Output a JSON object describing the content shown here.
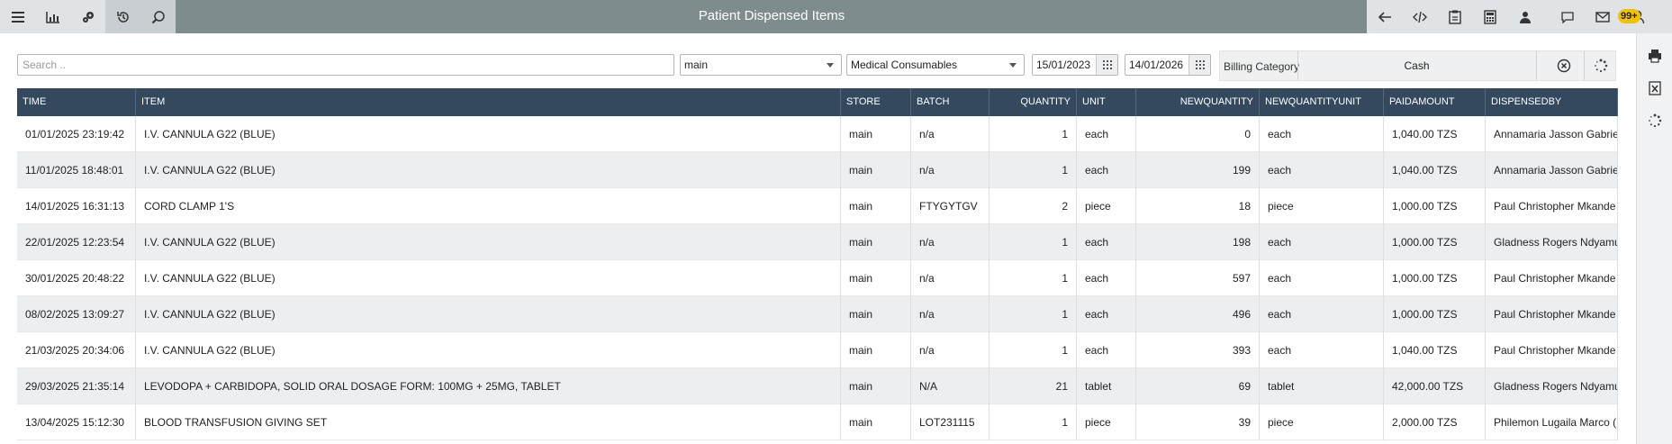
{
  "title": "Patient Dispensed Items",
  "badge": "99+",
  "search": {
    "placeholder": "Search .."
  },
  "filters": {
    "store": "main",
    "category": "Medical Consumables",
    "from_date": "15/01/2023",
    "to_date": "14/01/2026",
    "billing_label": "Billing Category",
    "billing_value": "Cash"
  },
  "icons": {
    "left": [
      "menu-icon",
      "bar-chart-icon",
      "settings-gears-icon",
      "history-icon",
      "search-icon"
    ],
    "right": [
      "back-arrow-icon",
      "code-icon",
      "clipboard-icon",
      "calculator-icon",
      "user-card-icon",
      "chat-icon",
      "mail-icon",
      "user-icon"
    ],
    "side": [
      "print-icon",
      "excel-icon",
      "refresh-spinner-icon"
    ]
  },
  "table": {
    "headers": [
      "TIME",
      "ITEM",
      "STORE",
      "BATCH",
      "QUANTITY",
      "UNIT",
      "NEWQUANTITY",
      "NEWQUANTITYUNIT",
      "PAIDAMOUNT",
      "DISPENSEDBY"
    ],
    "rows": [
      [
        "01/01/2025 23:19:42",
        "I.V. CANNULA G22 (BLUE)",
        "main",
        "n/a",
        "1",
        "each",
        "0",
        "each",
        "1,040.00 TZS",
        "Annamaria Jasson Gabriel ("
      ],
      [
        "11/01/2025 18:48:01",
        "I.V. CANNULA G22 (BLUE)",
        "main",
        "n/a",
        "1",
        "each",
        "199",
        "each",
        "1,040.00 TZS",
        "Annamaria Jasson Gabriel ("
      ],
      [
        "14/01/2025 16:31:13",
        "CORD CLAMP 1'S",
        "main",
        "FTYGYTGV",
        "2",
        "piece",
        "18",
        "piece",
        "1,000.00 TZS",
        "Paul Christopher Mkande (M"
      ],
      [
        "22/01/2025 12:23:54",
        "I.V. CANNULA G22 (BLUE)",
        "main",
        "n/a",
        "1",
        "each",
        "198",
        "each",
        "1,000.00 TZS",
        "Gladness Rogers Ndyamuka"
      ],
      [
        "30/01/2025 20:48:22",
        "I.V. CANNULA G22 (BLUE)",
        "main",
        "n/a",
        "1",
        "each",
        "597",
        "each",
        "1,000.00 TZS",
        "Paul Christopher Mkande (M"
      ],
      [
        "08/02/2025 13:09:27",
        "I.V. CANNULA G22 (BLUE)",
        "main",
        "n/a",
        "1",
        "each",
        "496",
        "each",
        "1,000.00 TZS",
        "Paul Christopher Mkande (M"
      ],
      [
        "21/03/2025 20:34:06",
        "I.V. CANNULA G22 (BLUE)",
        "main",
        "n/a",
        "1",
        "each",
        "393",
        "each",
        "1,040.00 TZS",
        "Paul Christopher Mkande (M"
      ],
      [
        "29/03/2025 21:35:14",
        "LEVODOPA + CARBIDOPA, SOLID ORAL DOSAGE FORM: 100MG + 25MG, TABLET",
        "main",
        "N/A",
        "21",
        "tablet",
        "69",
        "tablet",
        "42,000.00 TZS",
        "Gladness Rogers Ndyamuka"
      ],
      [
        "13/04/2025 15:12:30",
        "BLOOD TRANSFUSION GIVING SET",
        "main",
        "LOT231115",
        "1",
        "piece",
        "39",
        "piece",
        "2,000.00 TZS",
        "Philemon Lugaila Marco (MI"
      ]
    ]
  }
}
